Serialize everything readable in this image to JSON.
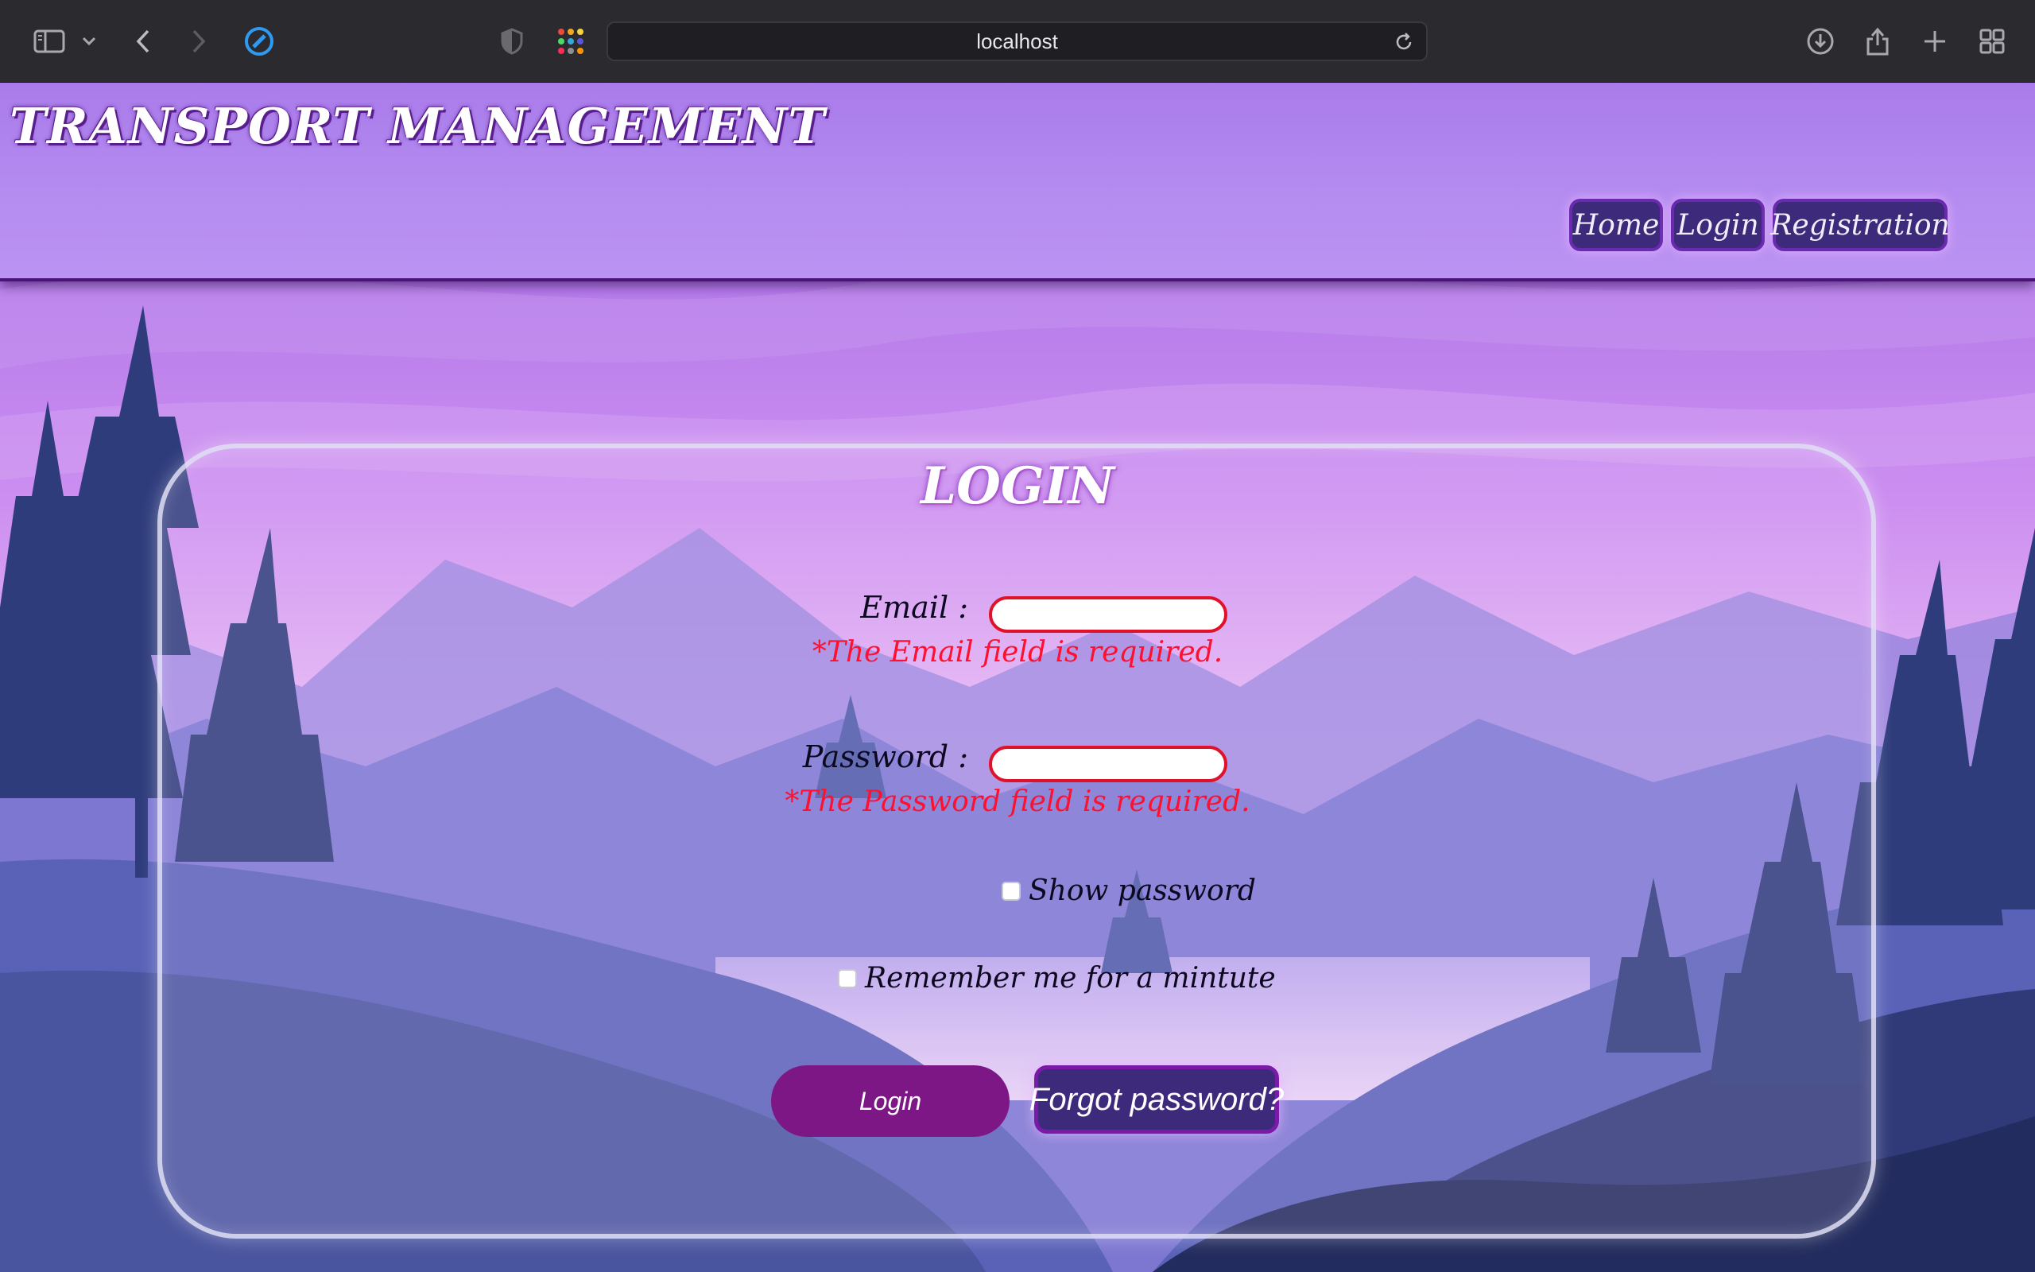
{
  "browser": {
    "url": "localhost",
    "icons": [
      "sidebar-icon",
      "chevron-down-icon",
      "back-icon",
      "forward-icon",
      "compass-icon",
      "shield-icon",
      "apps-grid-icon",
      "reload-icon",
      "download-icon",
      "share-icon",
      "new-tab-icon",
      "tab-overview-icon"
    ]
  },
  "site": {
    "title": "TRANSPORT MANAGEMENT",
    "nav": {
      "home": "Home",
      "login": "Login",
      "registration": "Registration"
    }
  },
  "login": {
    "heading": "LOGIN",
    "email_label": "Email :",
    "email_value": "",
    "email_error": "*The Email field is required.",
    "password_label": "Password :",
    "password_value": "",
    "password_error": "*The Password field is required.",
    "show_password_label": "Show password",
    "show_password_checked": false,
    "remember_label": "Remember me for a mintute",
    "remember_checked": false,
    "login_button": "Login",
    "forgot_button": "Forgot password?"
  },
  "colors": {
    "header_bg": "#b48bf0",
    "button_purple": "#7e1786",
    "nav_button_bg": "#3d2a7a",
    "error_red": "#ff1030"
  }
}
